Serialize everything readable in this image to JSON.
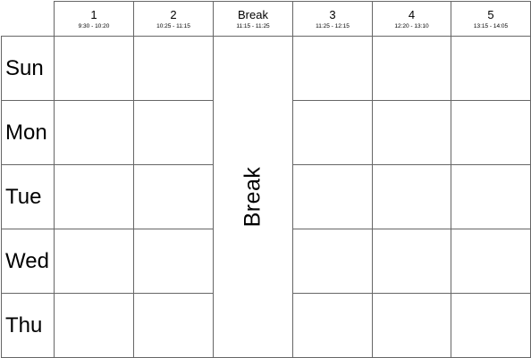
{
  "header": {
    "periods": [
      {
        "label": "1",
        "time": "9:30 - 10:20"
      },
      {
        "label": "2",
        "time": "10:25 - 11:15"
      },
      {
        "label": "Break",
        "time": "11:15 - 11:25"
      },
      {
        "label": "3",
        "time": "11:25 - 12:15"
      },
      {
        "label": "4",
        "time": "12:20 - 13:10"
      },
      {
        "label": "5",
        "time": "13:15 - 14:05"
      }
    ]
  },
  "days": [
    "Sun",
    "Mon",
    "Tue",
    "Wed",
    "Thu"
  ],
  "break_label": "Break"
}
